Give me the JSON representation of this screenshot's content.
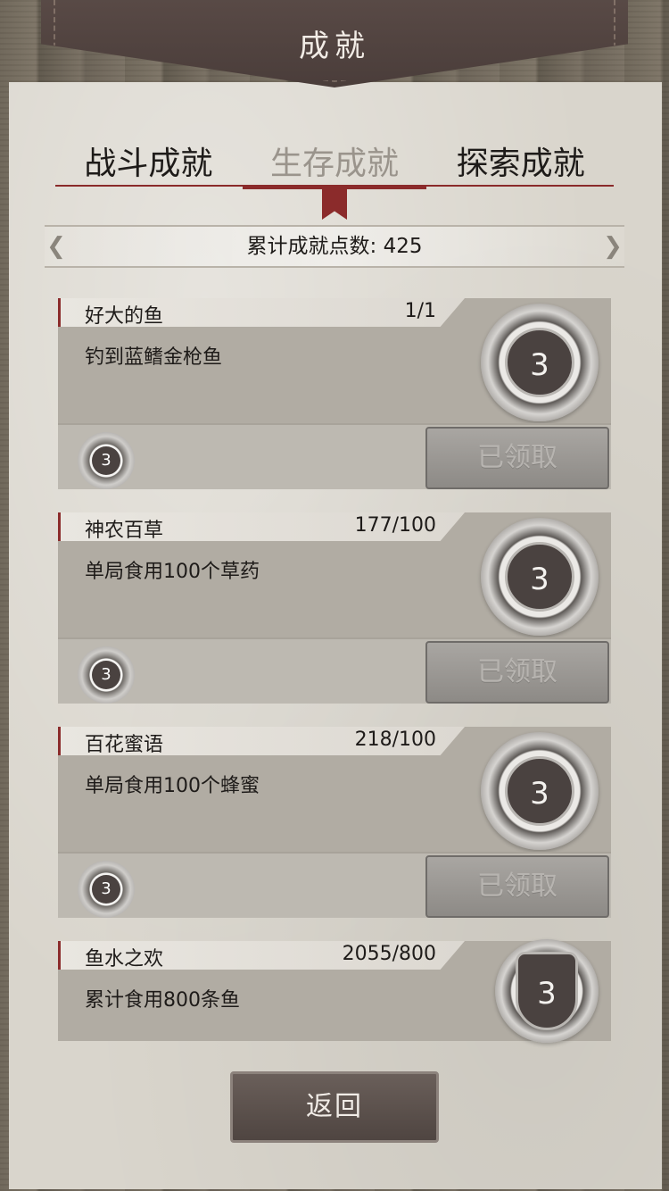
{
  "header": {
    "title": "成就"
  },
  "tabs": [
    {
      "label": "战斗成就",
      "active": false
    },
    {
      "label": "生存成就",
      "active": true
    },
    {
      "label": "探索成就",
      "active": false
    }
  ],
  "points_text": "累计成就点数: 425",
  "achievements": [
    {
      "name": "好大的鱼",
      "progress": "1/1",
      "desc": "钓到蓝鳍金枪鱼",
      "reward": "3",
      "medal_level": "3",
      "button": "已领取"
    },
    {
      "name": "神农百草",
      "progress": "177/100",
      "desc": "单局食用100个草药",
      "reward": "3",
      "medal_level": "3",
      "button": "已领取"
    },
    {
      "name": "百花蜜语",
      "progress": "218/100",
      "desc": "单局食用100个蜂蜜",
      "reward": "3",
      "medal_level": "3",
      "button": "已领取"
    },
    {
      "name": "鱼水之欢",
      "progress": "2055/800",
      "desc": "累计食用800条鱼",
      "medal_level": "3"
    }
  ],
  "back_label": "返回",
  "colors": {
    "accent_red": "#8b2b2b",
    "paper": "#d9d5cc",
    "banner": "#4a3d3a"
  }
}
